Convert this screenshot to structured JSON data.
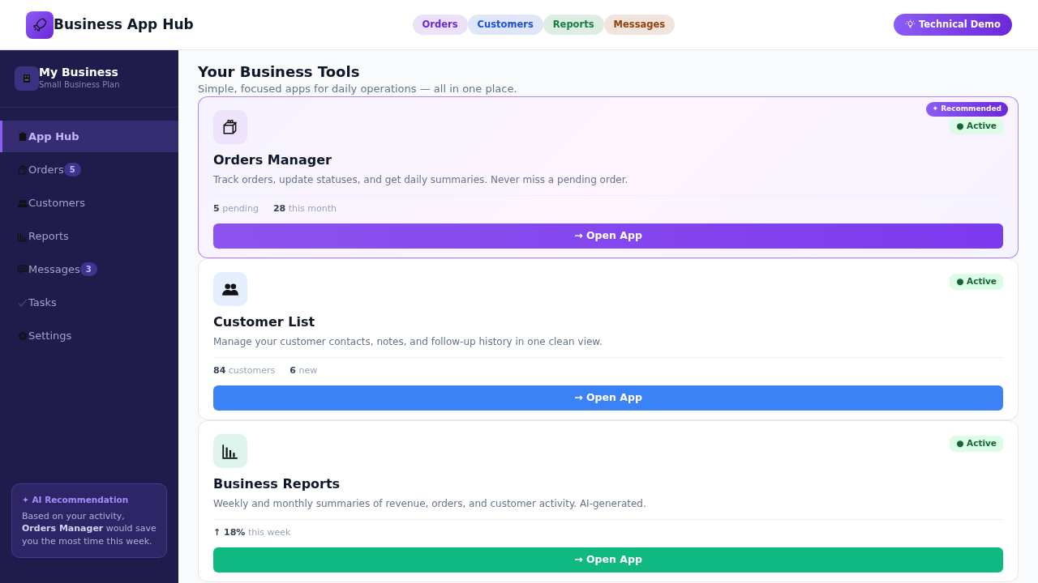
{
  "header": {
    "title": "Business App Hub",
    "pills": [
      {
        "label": "Orders",
        "color": "#6d28d9"
      },
      {
        "label": "Customers",
        "color": "#1d4ed8"
      },
      {
        "label": "Reports",
        "color": "#15803d"
      },
      {
        "label": "Messages",
        "color": "#92400e"
      }
    ],
    "demo_button": "Technical Demo"
  },
  "sidebar": {
    "business": {
      "name": "My Business",
      "plan": "Small Business Plan"
    },
    "items": [
      {
        "kind": "hub",
        "label": "App Hub",
        "selected": true
      },
      {
        "kind": "orders",
        "label": "Orders",
        "badge": "5",
        "selected": false
      },
      {
        "kind": "customers",
        "label": "Customers",
        "selected": false
      },
      {
        "kind": "reports",
        "label": "Reports",
        "selected": false
      },
      {
        "kind": "messages",
        "label": "Messages",
        "badge": "3",
        "selected": false
      },
      {
        "kind": "tasks",
        "label": "Tasks",
        "selected": false
      },
      {
        "kind": "settings",
        "label": "Settings",
        "selected": false
      }
    ],
    "ai_box": {
      "title": "✦ AI Recommendation",
      "text": "Based on your activity, **Orders Manager** would save you the most time this week."
    }
  },
  "main": {
    "title": "Your Business Tools",
    "subtitle": "Simple, focused apps for daily operations — all in one place.",
    "cards": [
      {
        "kind": "orders",
        "color": "#7c3aed",
        "recommended": true,
        "recommended_label": "✦ Recommended",
        "status": "● Active",
        "title": "Orders Manager",
        "description": "Track orders, update statuses, and get daily summaries. Never miss a pending order.",
        "stats": [
          "**5** pending",
          "**28** this month"
        ],
        "button": "→ Open App"
      },
      {
        "kind": "customers",
        "color": "#3b82f6",
        "recommended": false,
        "status": "● Active",
        "title": "Customer List",
        "description": "Manage your customer contacts, notes, and follow-up history in one clean view.",
        "stats": [
          "**84** customers",
          "**6** new"
        ],
        "button": "→ Open App"
      },
      {
        "kind": "reports",
        "color": "#10b981",
        "recommended": false,
        "status": "● Active",
        "title": "Business Reports",
        "description": "Weekly and monthly summaries of revenue, orders, and customer activity. AI-generated.",
        "stats": [
          "**↑ 18%** this week"
        ],
        "button": "→ Open App"
      }
    ]
  }
}
